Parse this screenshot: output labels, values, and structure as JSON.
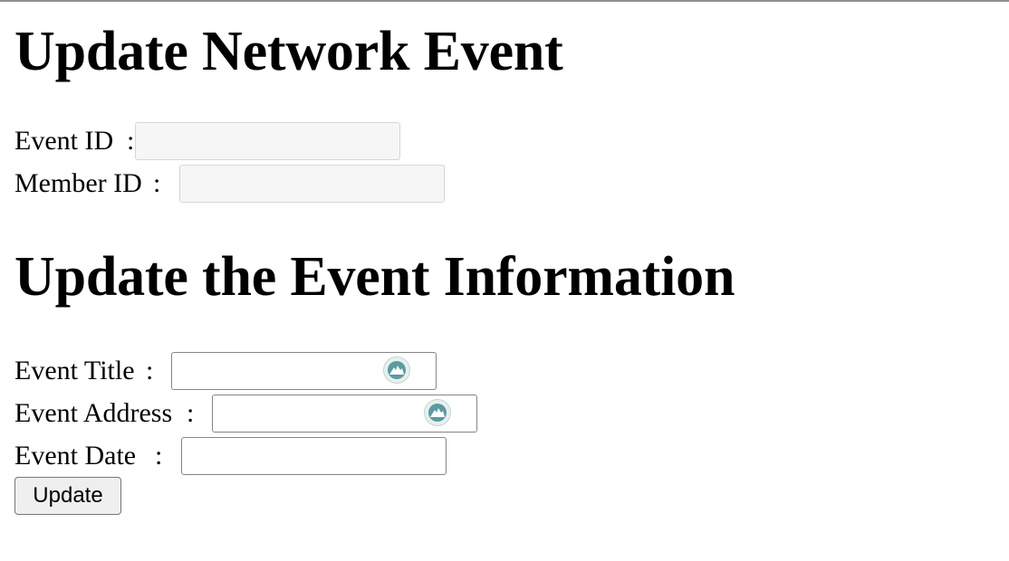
{
  "headings": {
    "network_event": "Update Network Event",
    "event_info": "Update the Event Information"
  },
  "lookup": {
    "event_id": {
      "label": "Event ID",
      "colon": ":",
      "value": "",
      "placeholder": ""
    },
    "member_id": {
      "label": "Member ID",
      "colon": ":",
      "value": "",
      "placeholder": ""
    }
  },
  "event_form": {
    "title": {
      "label": "Event Title",
      "colon": ":",
      "value": "",
      "placeholder": ""
    },
    "address": {
      "label": "Event Address",
      "colon": ":",
      "value": "",
      "placeholder": ""
    },
    "date": {
      "label": "Event Date",
      "colon": ":",
      "value": "",
      "placeholder": ""
    }
  },
  "buttons": {
    "update": "Update"
  },
  "icons": {
    "autofill": "password-manager-icon"
  },
  "colors": {
    "disabled_field_bg": "#f6f6f6",
    "icon_teal": "#5b9aa0"
  }
}
